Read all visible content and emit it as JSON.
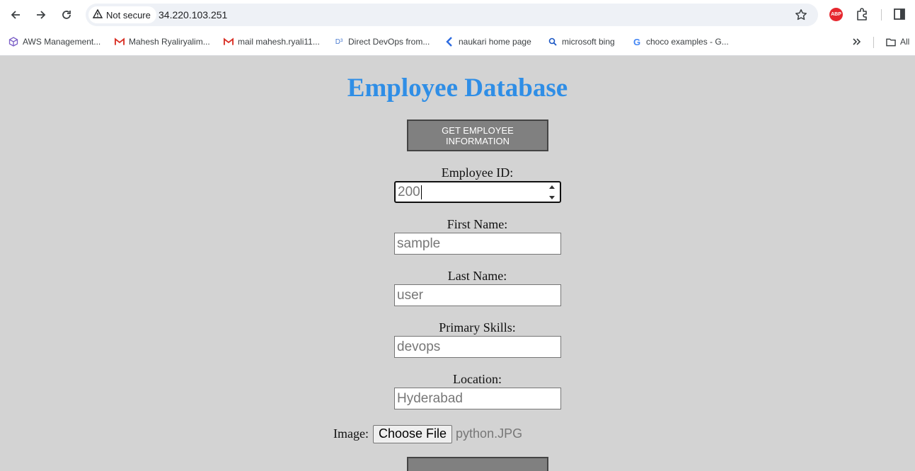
{
  "browser": {
    "security_label": "Not secure",
    "url": "34.220.103.251",
    "abp_label": "ABP",
    "bookmarks": [
      {
        "label": "AWS Management...",
        "icon": "aws-cube-icon"
      },
      {
        "label": "Mahesh Ryaliryalim...",
        "icon": "gmail-icon"
      },
      {
        "label": "mail mahesh.ryali11...",
        "icon": "gmail-icon"
      },
      {
        "label": "Direct DevOps from...",
        "icon": "devops-icon"
      },
      {
        "label": "naukari home page",
        "icon": "naukri-icon"
      },
      {
        "label": "microsoft bing",
        "icon": "search-icon"
      },
      {
        "label": "choco examples - G...",
        "icon": "google-icon"
      }
    ],
    "all_bookmarks_label": "All"
  },
  "page": {
    "title": "Employee Database",
    "get_button_label": "GET EMPLOYEE INFORMATION",
    "fields": {
      "employee_id": {
        "label": "Employee ID:",
        "value": "200"
      },
      "first_name": {
        "label": "First Name:",
        "placeholder": "sample"
      },
      "last_name": {
        "label": "Last Name:",
        "placeholder": "user"
      },
      "primary_skills": {
        "label": "Primary Skills:",
        "placeholder": "devops"
      },
      "location": {
        "label": "Location:",
        "placeholder": "Hyderabad"
      }
    },
    "image": {
      "label": "Image:",
      "choose_button_label": "Choose File",
      "file_name": "python.JPG"
    }
  },
  "colors": {
    "page_background": "#d3d3d3",
    "title": "#2f8ee6",
    "button_background": "#808080"
  }
}
